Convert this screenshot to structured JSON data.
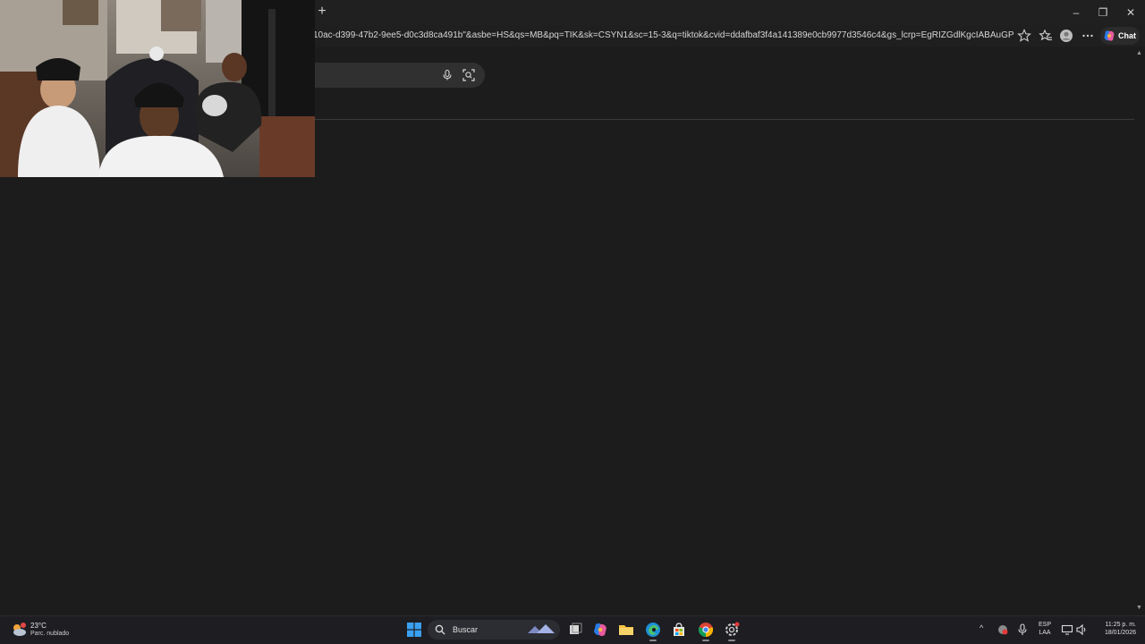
{
  "browser": {
    "url_text": "10ac-d399-47b2-9ee5-d0c3d8ca491b\"&asbe=HS&qs=MB&pq=TIK&sk=CSYN1&sc=15-3&q=tiktok&cvid=ddafbaf3f4a141389e0cb9977d3546c4&gs_lcrp=EgRIZGdlKgcIABAuGPkHMgcIAB...",
    "new_tab_symbol": "+",
    "chat_label": "Chat",
    "window_controls": {
      "minimize": "–",
      "restore": "❐",
      "close": "✕"
    },
    "toolbar_icons": [
      "star-add-icon",
      "favorites-icon",
      "profile-icon",
      "more-icon",
      "copilot-icon"
    ]
  },
  "page": {
    "search_icons": [
      "microphone-icon",
      "visual-search-icon"
    ]
  },
  "taskbar": {
    "weather": {
      "temp": "23°C",
      "desc": "Parc. nublado"
    },
    "search_placeholder": "Buscar",
    "apps": [
      "windows-start-icon",
      "task-view-icon",
      "copilot-icon",
      "file-explorer-icon",
      "edge-icon",
      "store-icon",
      "chrome-icon",
      "settings-icon"
    ],
    "language": {
      "line1": "ESP",
      "line2": "LAA"
    },
    "clock": {
      "time": "11:25 p. m.",
      "date": "18/01/2026"
    },
    "tray_icons": [
      "chevron-up-icon",
      "network-icon",
      "microphone-icon",
      "display-icon",
      "volume-icon"
    ]
  },
  "colors": {
    "background": "#1b1b1b",
    "taskbar": "#1d1d22",
    "edge_accent": "#1e8fd6",
    "start_accent": "#3aa0f0"
  }
}
